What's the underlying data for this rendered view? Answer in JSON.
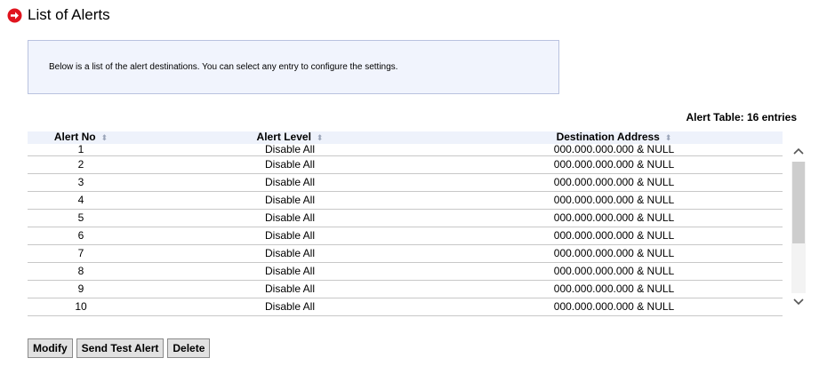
{
  "page": {
    "title": "List of Alerts"
  },
  "info": {
    "message": "Below is a list of the alert destinations. You can select any entry to configure the settings."
  },
  "table": {
    "count_label": "Alert Table: 16 entries",
    "columns": [
      "Alert No",
      "Alert Level",
      "Destination Address"
    ],
    "rows": [
      [
        "1",
        "Disable All",
        "000.000.000.000 & NULL"
      ],
      [
        "2",
        "Disable All",
        "000.000.000.000 & NULL"
      ],
      [
        "3",
        "Disable All",
        "000.000.000.000 & NULL"
      ],
      [
        "4",
        "Disable All",
        "000.000.000.000 & NULL"
      ],
      [
        "5",
        "Disable All",
        "000.000.000.000 & NULL"
      ],
      [
        "6",
        "Disable All",
        "000.000.000.000 & NULL"
      ],
      [
        "7",
        "Disable All",
        "000.000.000.000 & NULL"
      ],
      [
        "8",
        "Disable All",
        "000.000.000.000 & NULL"
      ],
      [
        "9",
        "Disable All",
        "000.000.000.000 & NULL"
      ],
      [
        "10",
        "Disable All",
        "000.000.000.000 & NULL"
      ]
    ]
  },
  "buttons": {
    "modify": "Modify",
    "send_test": "Send Test Alert",
    "delete": "Delete"
  },
  "icons": {
    "title_icon": "red-circle-arrow-icon",
    "sort": "sort-arrows-icon"
  },
  "colors": {
    "accent_red": "#e0141e",
    "header_bg": "#eef2fb",
    "info_bg": "#f1f4fd"
  }
}
